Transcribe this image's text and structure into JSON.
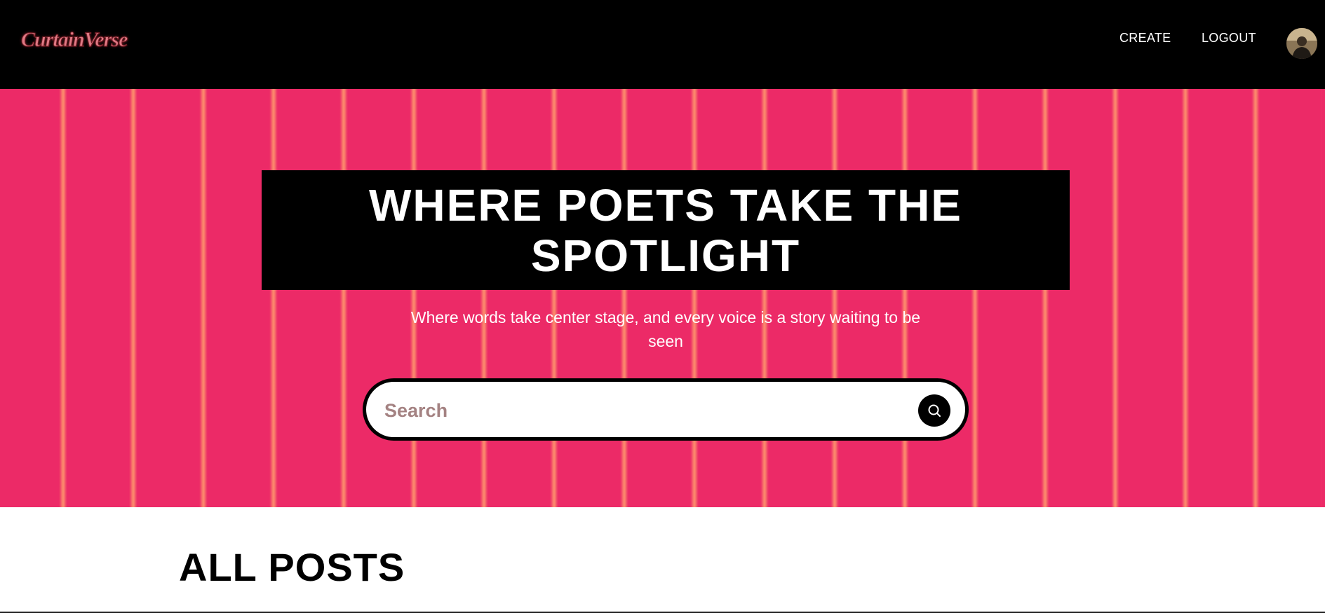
{
  "header": {
    "logo_text": "CurtainVerse",
    "nav": [
      {
        "label": "CREATE"
      },
      {
        "label": "LOGOUT"
      }
    ],
    "avatar_icon": "user-avatar"
  },
  "hero": {
    "title": "WHERE POETS TAKE THE SPOTLIGHT",
    "subtitle": "Where words take center stage, and every voice is a story waiting to be seen",
    "search": {
      "placeholder": "Search",
      "value": "",
      "button_icon": "search-icon"
    }
  },
  "posts": {
    "heading": "ALL POSTS"
  },
  "colors": {
    "header_bg": "#000000",
    "hero_bg": "#ec2a67",
    "curtain_stripe": "#fc8d6c",
    "text_light": "#ffffff",
    "text_dark": "#000000"
  }
}
